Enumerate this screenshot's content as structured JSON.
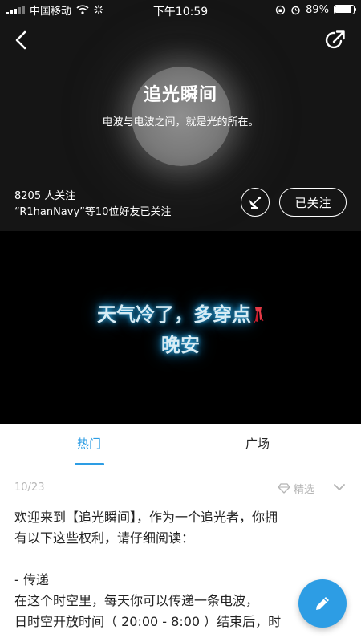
{
  "status_bar": {
    "carrier": "中国移动",
    "time": "下午10:59",
    "battery": "89%",
    "battery_level": 0.89
  },
  "header": {
    "title": "追光瞬间",
    "subtitle": "电波与电波之间，就是光的所在。",
    "followers": "8205 人关注",
    "friends_following": "“R1hanNavy”等10位好友已关注",
    "follow_button": "已关注"
  },
  "banner": {
    "line1": "天气冷了，多穿点",
    "line2": "晚安"
  },
  "tabs": [
    {
      "label": "热门",
      "active": true
    },
    {
      "label": "广场",
      "active": false
    }
  ],
  "post": {
    "date": "10/23",
    "featured_label": "精选",
    "lines": [
      "欢迎来到【追光瞬间】，作为一个追光者，你拥",
      "有以下这些权利，请仔细阅读：",
      "",
      "- 传递",
      "在这个时空里，每天你可以传递一条电波，",
      "日时空开放时间（ 20:00 - 8:00 ）结束后，时"
    ]
  },
  "colors": {
    "accent": "#2d9de4",
    "header_bg": "#151515",
    "banner_glow": "#1e8fcf"
  },
  "icons": [
    "back-arrow-icon",
    "share-icon",
    "satellite-dish-icon",
    "featured-diamond-icon",
    "chevron-down-icon",
    "pencil-icon",
    "scarf-emoji-icon"
  ]
}
